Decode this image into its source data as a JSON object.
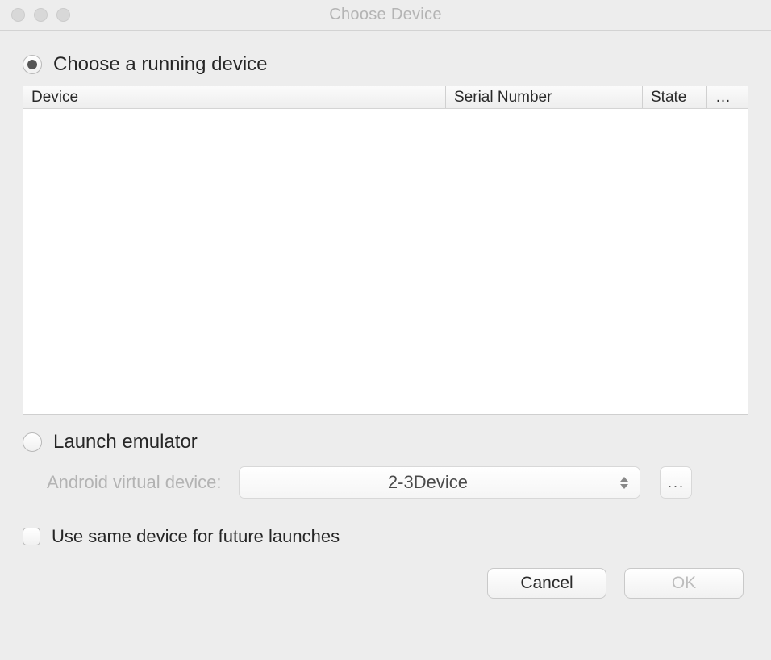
{
  "window": {
    "title": "Choose Device"
  },
  "options": {
    "choose_running_label": "Choose a running device",
    "launch_emulator_label": "Launch emulator",
    "use_same_label": "Use same device for future launches"
  },
  "table": {
    "headers": {
      "device": "Device",
      "serial": "Serial Number",
      "state": "State",
      "more": "…"
    }
  },
  "avd": {
    "label": "Android virtual device:",
    "selected": "2-3Device",
    "browse_glyph": "..."
  },
  "buttons": {
    "cancel": "Cancel",
    "ok": "OK"
  }
}
